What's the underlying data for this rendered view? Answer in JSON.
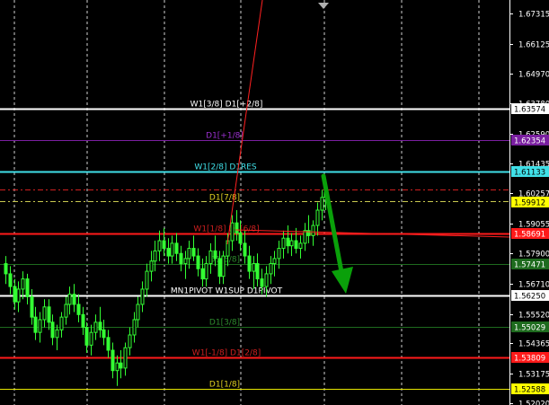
{
  "chart_data": {
    "type": "candlestick",
    "grid": true,
    "ylim": [
      1.5195,
      1.6785
    ],
    "price_ticks": [
      "1.67315",
      "1.66125",
      "1.64970",
      "1.63780",
      "1.62590",
      "1.61435",
      "1.60257",
      "1.59055",
      "1.57900",
      "1.56710",
      "1.55520",
      "1.54365",
      "1.53175",
      "1.52020"
    ],
    "levels": [
      {
        "name": "W1[3/8] D1[+2/8]",
        "price": 1.63574,
        "tag": "1.63574",
        "color": "#ffffff",
        "text_color": "#ffffff",
        "tag_bg": "#ffffff",
        "tag_fg": "#000000",
        "dash": false,
        "width": 2
      },
      {
        "name": "D1[+1/8]",
        "price": 1.62354,
        "tag": "1.62354",
        "color": "#7a1fa0",
        "text_color": "#9b30d0",
        "tag_bg": "#7a1fa0",
        "tag_fg": "#ffffff",
        "dash": false,
        "width": 1
      },
      {
        "name": "W1[2/8] D1RES",
        "price": 1.61133,
        "tag": "1.61133",
        "color": "#40e0e8",
        "text_color": "#40e0e8",
        "tag_bg": "#40e0e8",
        "tag_fg": "#000000",
        "dash": false,
        "width": 2
      },
      {
        "name": "",
        "price": 1.604,
        "tag": "",
        "color": "#d02020",
        "dash": true,
        "width": 1
      },
      {
        "name": "",
        "price": 1.5996,
        "tag": "",
        "color": "#c8c850",
        "dash": true,
        "width": 1
      },
      {
        "name": "D1[7/8]",
        "price": 1.59912,
        "tag": "1.59912",
        "color": "#d4c820",
        "text_color": "#e0d020",
        "tag_bg": "#ffff00",
        "tag_fg": "#000000",
        "dash": false,
        "width": 1,
        "no_line": true
      },
      {
        "name": "W1[1/8] D1[6/8]",
        "price": 1.58691,
        "tag": "1.58691",
        "color": "#ff1a1a",
        "text_color": "#d02020",
        "tag_bg": "#ff1a1a",
        "tag_fg": "#ffffff",
        "dash": false,
        "width": 2
      },
      {
        "name": "D1[5/8]",
        "price": 1.57471,
        "tag": "1.57471",
        "color": "#1e6b1e",
        "text_color": "#2e8b2e",
        "tag_bg": "#1e6b1e",
        "tag_fg": "#ffffff",
        "dash": false,
        "width": 1
      },
      {
        "name": "MN1PIVOT W1SUP D1PIVOT",
        "price": 1.5625,
        "tag": "1.56250",
        "color": "#ffffff",
        "text_color": "#ffffff",
        "tag_bg": "#ffffff",
        "tag_fg": "#000000",
        "dash": false,
        "width": 2
      },
      {
        "name": "D1[3/8]",
        "price": 1.55029,
        "tag": "1.55029",
        "color": "#1e6b1e",
        "text_color": "#2e8b2e",
        "tag_bg": "#1e6b1e",
        "tag_fg": "#ffffff",
        "dash": false,
        "width": 1
      },
      {
        "name": "W1[-1/8] D1[2/8]",
        "price": 1.53809,
        "tag": "1.53809",
        "color": "#ff1a1a",
        "text_color": "#d02020",
        "tag_bg": "#ff1a1a",
        "tag_fg": "#ffffff",
        "dash": false,
        "width": 2
      },
      {
        "name": "D1[1/8]",
        "price": 1.52588,
        "tag": "1.52588",
        "color": "#e6e600",
        "text_color": "#e0d020",
        "tag_bg": "#ffff00",
        "tag_fg": "#000000",
        "dash": false,
        "width": 1
      }
    ],
    "candles": [
      [
        1.575,
        1.578,
        1.567,
        1.571
      ],
      [
        1.571,
        1.574,
        1.563,
        1.566
      ],
      [
        1.566,
        1.569,
        1.557,
        1.56
      ],
      [
        1.56,
        1.568,
        1.556,
        1.565
      ],
      [
        1.565,
        1.572,
        1.561,
        1.569
      ],
      [
        1.569,
        1.571,
        1.559,
        1.562
      ],
      [
        1.562,
        1.565,
        1.551,
        1.554
      ],
      [
        1.554,
        1.558,
        1.545,
        1.548
      ],
      [
        1.548,
        1.556,
        1.544,
        1.553
      ],
      [
        1.553,
        1.561,
        1.55,
        1.558
      ],
      [
        1.558,
        1.561,
        1.549,
        1.552
      ],
      [
        1.552,
        1.555,
        1.543,
        1.546
      ],
      [
        1.546,
        1.551,
        1.541,
        1.549
      ],
      [
        1.549,
        1.556,
        1.546,
        1.554
      ],
      [
        1.554,
        1.562,
        1.551,
        1.559
      ],
      [
        1.559,
        1.566,
        1.555,
        1.563
      ],
      [
        1.563,
        1.567,
        1.556,
        1.559
      ],
      [
        1.559,
        1.563,
        1.552,
        1.555
      ],
      [
        1.555,
        1.558,
        1.547,
        1.55
      ],
      [
        1.55,
        1.552,
        1.54,
        1.543
      ],
      [
        1.543,
        1.551,
        1.539,
        1.548
      ],
      [
        1.548,
        1.555,
        1.545,
        1.552
      ],
      [
        1.552,
        1.558,
        1.546,
        1.549
      ],
      [
        1.549,
        1.553,
        1.543,
        1.546
      ],
      [
        1.546,
        1.549,
        1.538,
        1.541
      ],
      [
        1.541,
        1.544,
        1.53,
        1.533
      ],
      [
        1.533,
        1.539,
        1.527,
        1.536
      ],
      [
        1.536,
        1.541,
        1.53,
        1.534
      ],
      [
        1.534,
        1.544,
        1.531,
        1.542
      ],
      [
        1.542,
        1.55,
        1.539,
        1.547
      ],
      [
        1.547,
        1.556,
        1.544,
        1.553
      ],
      [
        1.553,
        1.562,
        1.55,
        1.559
      ],
      [
        1.559,
        1.568,
        1.556,
        1.565
      ],
      [
        1.565,
        1.575,
        1.562,
        1.572
      ],
      [
        1.572,
        1.58,
        1.568,
        1.576
      ],
      [
        1.576,
        1.584,
        1.572,
        1.58
      ],
      [
        1.58,
        1.588,
        1.576,
        1.584
      ],
      [
        1.584,
        1.589,
        1.578,
        1.581
      ],
      [
        1.581,
        1.585,
        1.575,
        1.578
      ],
      [
        1.578,
        1.586,
        1.575,
        1.583
      ],
      [
        1.583,
        1.587,
        1.576,
        1.579
      ],
      [
        1.579,
        1.582,
        1.572,
        1.575
      ],
      [
        1.575,
        1.58,
        1.569,
        1.577
      ],
      [
        1.577,
        1.584,
        1.573,
        1.581
      ],
      [
        1.581,
        1.586,
        1.576,
        1.578
      ],
      [
        1.578,
        1.581,
        1.57,
        1.573
      ],
      [
        1.573,
        1.577,
        1.566,
        1.569
      ],
      [
        1.569,
        1.578,
        1.566,
        1.575
      ],
      [
        1.575,
        1.583,
        1.571,
        1.58
      ],
      [
        1.58,
        1.586,
        1.574,
        1.577
      ],
      [
        1.577,
        1.58,
        1.567,
        1.57
      ],
      [
        1.57,
        1.58,
        1.567,
        1.578
      ],
      [
        1.578,
        1.587,
        1.574,
        1.584
      ],
      [
        1.584,
        1.594,
        1.58,
        1.591
      ],
      [
        1.591,
        1.596,
        1.584,
        1.587
      ],
      [
        1.587,
        1.592,
        1.58,
        1.583
      ],
      [
        1.583,
        1.588,
        1.575,
        1.578
      ],
      [
        1.578,
        1.582,
        1.569,
        1.572
      ],
      [
        1.572,
        1.578,
        1.565,
        1.575
      ],
      [
        1.575,
        1.579,
        1.566,
        1.569
      ],
      [
        1.569,
        1.573,
        1.563,
        1.566
      ],
      [
        1.566,
        1.574,
        1.562,
        1.571
      ],
      [
        1.571,
        1.578,
        1.567,
        1.575
      ],
      [
        1.575,
        1.58,
        1.57,
        1.577
      ],
      [
        1.577,
        1.584,
        1.573,
        1.581
      ],
      [
        1.581,
        1.588,
        1.577,
        1.585
      ],
      [
        1.585,
        1.59,
        1.579,
        1.582
      ],
      [
        1.582,
        1.587,
        1.578,
        1.584
      ],
      [
        1.584,
        1.589,
        1.579,
        1.581
      ],
      [
        1.581,
        1.586,
        1.577,
        1.583
      ],
      [
        1.583,
        1.591,
        1.58,
        1.588
      ],
      [
        1.588,
        1.594,
        1.583,
        1.586
      ],
      [
        1.586,
        1.592,
        1.582,
        1.59
      ],
      [
        1.59,
        1.599,
        1.586,
        1.596
      ],
      [
        1.596,
        1.604,
        1.592,
        1.601
      ],
      [
        1.601,
        1.606,
        1.596,
        1.603
      ]
    ]
  }
}
